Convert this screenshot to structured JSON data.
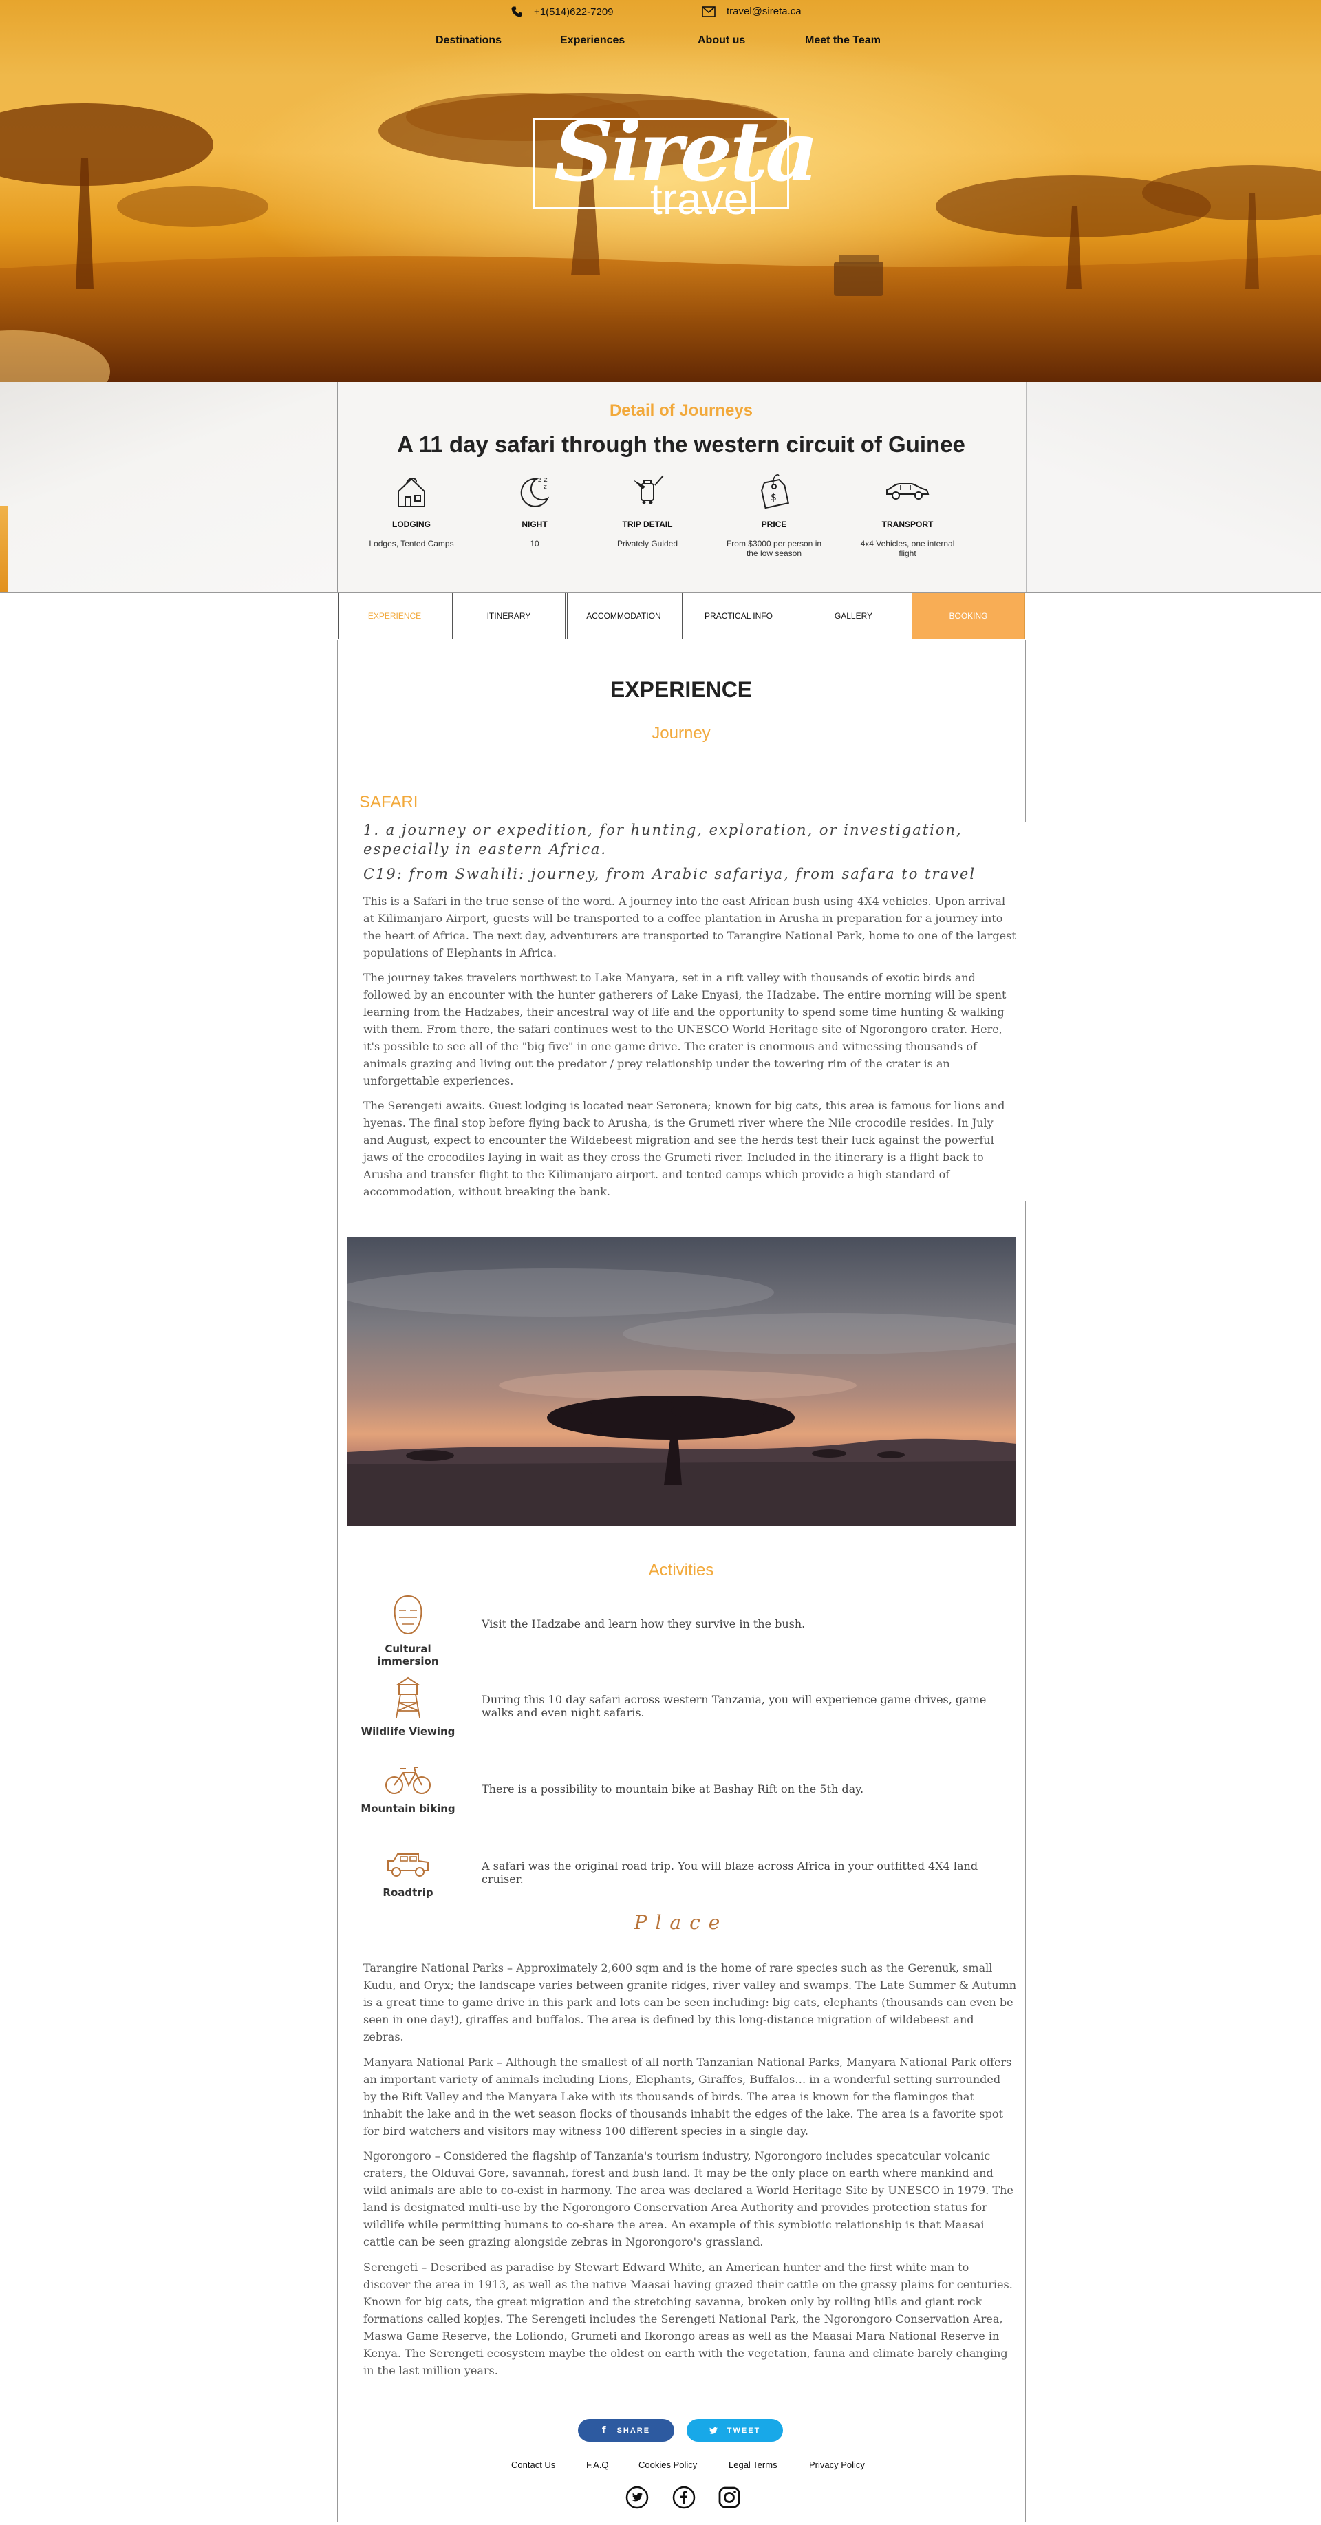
{
  "contact": {
    "phone": "+1(514)622-7209",
    "email": "travel@sireta.ca"
  },
  "nav": [
    "Destinations",
    "Experiences",
    "About us",
    "Meet the Team"
  ],
  "logo": {
    "line1": "Sireta",
    "line2": "travel"
  },
  "detail": {
    "subtitle": "Detail of Journeys",
    "title": "A 11 day safari through the western circuit of Guinee",
    "features": [
      {
        "icon": "lodging-icon",
        "label": "LODGING",
        "value": "Lodges, Tented Camps"
      },
      {
        "icon": "night-moon-icon",
        "label": "NIGHT",
        "value": "10"
      },
      {
        "icon": "trip-detail-icon",
        "label": "TRIP DETAIL",
        "value": "Privately Guided"
      },
      {
        "icon": "price-tag-icon",
        "label": "PRICE",
        "value": "From $3000 per person in the low season"
      },
      {
        "icon": "car-icon",
        "label": "TRANSPORT",
        "value": "4x4 Vehicles, one internal flight"
      }
    ]
  },
  "tabs": [
    "EXPERIENCE",
    "ITINERARY",
    "ACCOMMODATION",
    "PRACTICAL INFO",
    "GALLERY",
    "BOOKING"
  ],
  "main": {
    "heading": "EXPERIENCE",
    "subheading": "Journey",
    "safari_heading": "SAFARI",
    "definition1": "1. a journey or expedition, for hunting, exploration, or investigation, especially in eastern Africa.",
    "definition2": "C19: from Swahili: journey, from Arabic safariya, from safara to travel",
    "paragraphs": [
      "This is a Safari in the true sense of the word. A journey into the east African bush using 4X4 vehicles.  Upon arrival at Kilimanjaro Airport, guests will be transported to a coffee plantation in Arusha in preparation for a journey into the heart of Africa. The next day, adventurers are transported to Tarangire National Park, home to one of the largest populations of Elephants in Africa.",
      "The journey takes travelers northwest to Lake Manyara, set in a rift valley with thousands of exotic birds and followed by an encounter with the hunter gatherers of Lake Enyasi, the Hadzabe. The entire morning will be spent learning from the Hadzabes, their ancestral way of life and the opportunity to spend some time hunting & walking with them. From there, the safari continues west to the UNESCO World Heritage site of Ngorongoro crater. Here, it's possible to see all of the \"big five\" in one game drive. The crater is enormous and witnessing thousands of animals grazing and living out the predator / prey relationship under the towering rim of the crater is an unforgettable experiences.",
      "The Serengeti awaits.  Guest lodging is located near Seronera; known for big cats, this area is famous for lions and hyenas. The final stop before flying back to Arusha, is the Grumeti river where the Nile crocodile resides.  In July and August, expect to encounter the Wildebeest migration and see the herds test their luck against the powerful jaws of the crocodiles laying in wait as they cross the Grumeti river. Included in the itinerary is a flight back to Arusha and transfer flight to the Kilimanjaro airport.  and tented camps which provide a high standard of accommodation, without breaking the bank."
    ]
  },
  "activities": {
    "heading": "Activities",
    "items": [
      {
        "icon": "mask-icon",
        "label": "Cultural immersion",
        "text": "Visit the Hadzabe and learn how they survive in the bush."
      },
      {
        "icon": "watchtower-icon",
        "label": "Wildlife Viewing",
        "text": "During this 10 day safari across western Tanzania, you will experience game drives, game walks and even night safaris."
      },
      {
        "icon": "bicycle-icon",
        "label": "Mountain biking",
        "text": "There is a possibility to mountain bike at Bashay Rift on the 5th day."
      },
      {
        "icon": "jeep-icon",
        "label": "Roadtrip",
        "text": "A safari was the original road trip. You will blaze across Africa in your outfitted 4X4 land cruiser."
      }
    ]
  },
  "place": {
    "heading": "Place",
    "paragraphs": [
      "Tarangire National Parks – Approximately  2,600 sqm and is the home of rare species such as the Gerenuk, small Kudu, and Oryx; the landscape varies  between granite ridges, river valley and swamps. The Late Summer & Autumn is a great time to game drive in this park and lots can be seen including: big cats, elephants (thousands can even be seen in one day!), giraffes and buffalos.  The area is defined by this long-distance migration of wildebeest and zebras.",
      "Manyara National Park – Although the smallest of all north Tanzanian National Parks, Manyara National Park offers an important variety of animals including Lions, Elephants, Giraffes, Buffalos… in a wonderful setting surrounded by the Rift Valley and the Manyara Lake with its thousands of birds.  The area is known for the flamingos that inhabit the lake and in the wet season flocks of thousands inhabit the edges of the lake.  The area is a favorite spot for bird watchers and visitors may witness 100 different species in a single day.",
      "Ngorongoro – Considered the flagship of Tanzania's tourism industry, Ngorongoro includes specatcular volcanic craters, the Olduvai Gore, savannah, forest and bush land.  It may be the only place on earth where mankind and wild animals are able to co-exist in harmony.  The area was declared a World Heritage Site by UNESCO in 1979.  The land is designated multi-use by the Ngorongoro Conservation Area Authority and provides protection status for wildlife while permitting humans to co-share the area.  An example of this symbiotic relationship is that Maasai cattle can be seen grazing alongside zebras in Ngorongoro's grassland.",
      "Serengeti – Described as paradise by Stewart Edward White, an American hunter and the first white man to discover the area in 1913, as well as the native Maasai having grazed their cattle on the grassy plains for centuries.   Known for big cats, the great migration and the stretching savanna, broken only by rolling hills and giant rock formations called kopjes.  The Serengeti includes the Serengeti National Park, the Ngorongoro Conservation Area, Maswa Game Reserve, the Loliondo, Grumeti and Ikorongo areas as well as the Maasai Mara National Reserve in Kenya.  The Serengeti ecosystem maybe the oldest on earth with the vegetation, fauna and climate barely changing in the last million years."
    ]
  },
  "share": {
    "share_label": "SHARE",
    "tweet_label": "TWEET"
  },
  "footer": {
    "links": [
      "Contact Us",
      "F.A.Q",
      "Cookies Policy",
      "Legal Terms",
      "Privacy Policy"
    ]
  },
  "colors": {
    "accent": "#f2a93b",
    "booking": "#f8ad55",
    "share": "#2d5aa0",
    "tweet": "#18a8e8"
  }
}
